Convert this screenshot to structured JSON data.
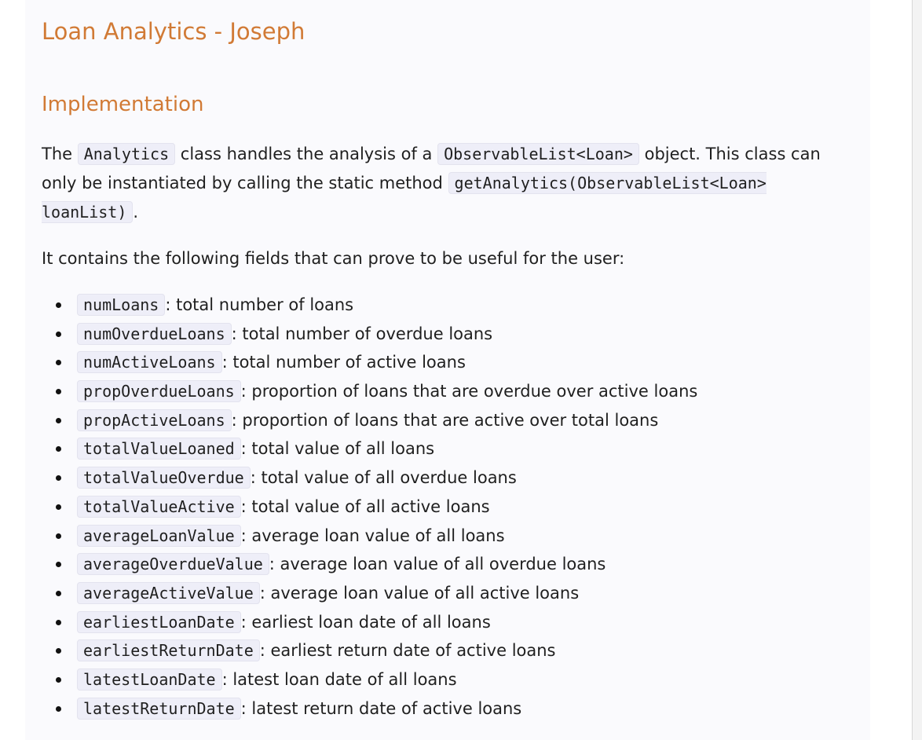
{
  "page": {
    "title": "Loan Analytics - Joseph",
    "heading": "Implementation",
    "intro": {
      "t1": "The ",
      "code1": "Analytics",
      "t2": " class handles the analysis of a ",
      "code2": "ObservableList<Loan>",
      "t3": " object. This class can only be instantiated by calling the static method ",
      "code3": "getAnalytics(ObservableList<Loan> loanList)",
      "t4": "."
    },
    "fields_intro": "It contains the following fields that can prove to be useful for the user:",
    "fields": [
      {
        "name": "numLoans",
        "desc": ": total number of loans"
      },
      {
        "name": "numOverdueLoans",
        "desc": ": total number of overdue loans"
      },
      {
        "name": "numActiveLoans",
        "desc": ": total number of active loans"
      },
      {
        "name": "propOverdueLoans",
        "desc": ": proportion of loans that are overdue over active loans"
      },
      {
        "name": "propActiveLoans",
        "desc": ": proportion of loans that are active over total loans"
      },
      {
        "name": "totalValueLoaned",
        "desc": ": total value of all loans"
      },
      {
        "name": "totalValueOverdue",
        "desc": ": total value of all overdue loans"
      },
      {
        "name": "totalValueActive",
        "desc": ": total value of all active loans"
      },
      {
        "name": "averageLoanValue",
        "desc": ": average loan value of all loans"
      },
      {
        "name": "averageOverdueValue",
        "desc": ": average loan value of all overdue loans"
      },
      {
        "name": "averageActiveValue",
        "desc": ": average loan value of all active loans"
      },
      {
        "name": "earliestLoanDate",
        "desc": ": earliest loan date of all loans"
      },
      {
        "name": "earliestReturnDate",
        "desc": ": earliest return date of active loans"
      },
      {
        "name": "latestLoanDate",
        "desc": ": latest loan date of all loans"
      },
      {
        "name": "latestReturnDate",
        "desc": ": latest return date of active loans"
      }
    ]
  },
  "colors": {
    "heading": "#d17a35",
    "text": "#1f1f1f",
    "code_bg": "#eeeef8",
    "page_bg": "#fafafd"
  }
}
